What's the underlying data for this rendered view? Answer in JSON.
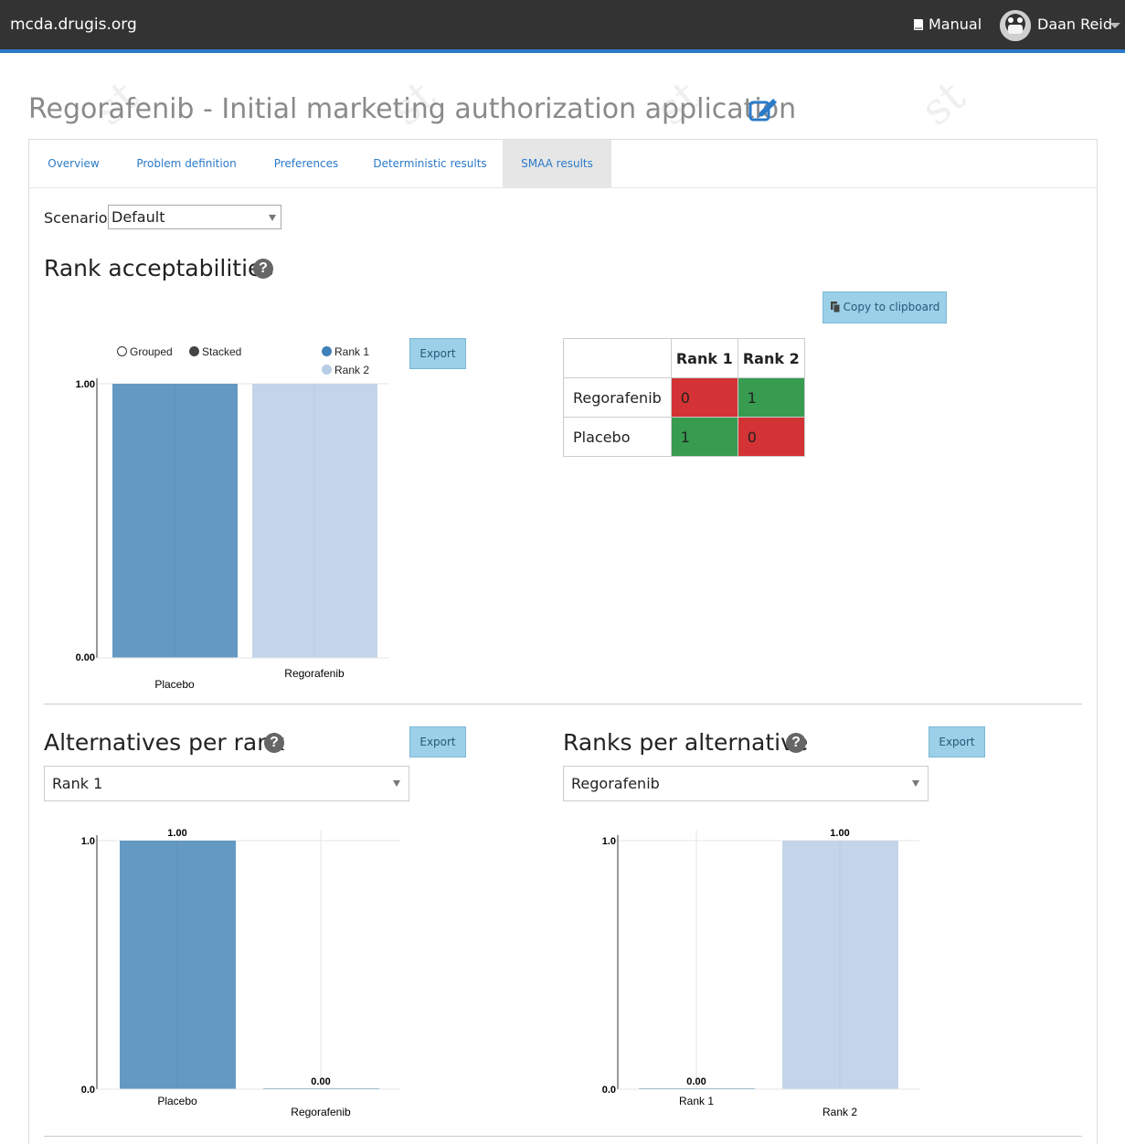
{
  "nav": {
    "brand": "mcda.drugis.org",
    "manual": "Manual",
    "user": "Daan Reid"
  },
  "page_title": "Regorafenib - Initial marketing authorization application",
  "tabs": [
    {
      "label": "Overview"
    },
    {
      "label": "Problem definition"
    },
    {
      "label": "Preferences"
    },
    {
      "label": "Deterministic results"
    },
    {
      "label": "SMAA results"
    }
  ],
  "scenario": {
    "label": "Scenario:",
    "value": "Default"
  },
  "rank_acceptabilities": {
    "heading": "Rank acceptabilities",
    "export_label": "Export",
    "copy_label": "Copy to clipboard",
    "legend": {
      "grouped": "Grouped",
      "stacked": "Stacked",
      "rank1": "Rank 1",
      "rank2": "Rank 2"
    },
    "table": {
      "headers": [
        "",
        "Rank 1",
        "Rank 2"
      ],
      "rows": [
        {
          "name": "Regorafenib",
          "values": [
            "0",
            "1"
          ]
        },
        {
          "name": "Placebo",
          "values": [
            "1",
            "0"
          ]
        }
      ]
    }
  },
  "alternatives_per_rank": {
    "heading": "Alternatives per rank",
    "export_label": "Export",
    "selected": "Rank 1"
  },
  "ranks_per_alternative": {
    "heading": "Ranks per alternative",
    "export_label": "Export",
    "selected": "Regorafenib"
  },
  "colors": {
    "rank1": "#6399c3",
    "rank2": "#c4d5ea",
    "red": "#d33334",
    "green": "#379b50",
    "accent": "#2a7ac9"
  },
  "chart_data": [
    {
      "type": "bar",
      "categories": [
        "Placebo",
        "Regorafenib"
      ],
      "series": [
        {
          "name": "Rank 1",
          "values": [
            1,
            0
          ]
        },
        {
          "name": "Rank 2",
          "values": [
            0,
            1
          ]
        }
      ],
      "mode": "stacked",
      "ylim": [
        0,
        1
      ],
      "yticks": [
        "0.00",
        "1.00"
      ],
      "legend": "top-right"
    },
    {
      "type": "bar",
      "categories": [
        "Placebo",
        "Regorafenib"
      ],
      "values": [
        1.0,
        0.0
      ],
      "data_labels": [
        "1.00",
        "0.00"
      ],
      "ylim": [
        0,
        1
      ],
      "yticks": [
        "0.0",
        "1.0"
      ]
    },
    {
      "type": "bar",
      "categories": [
        "Rank 1",
        "Rank 2"
      ],
      "values": [
        0.0,
        1.0
      ],
      "data_labels": [
        "0.00",
        "1.00"
      ],
      "ylim": [
        0,
        1
      ],
      "yticks": [
        "0.0",
        "1.0"
      ]
    }
  ]
}
